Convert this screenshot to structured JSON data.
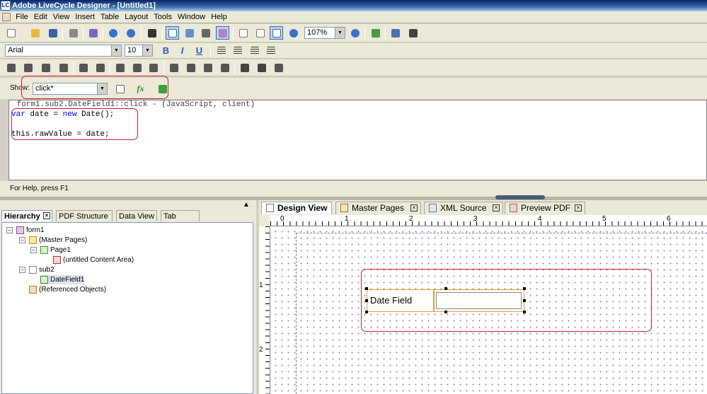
{
  "app": {
    "title": "Adobe LiveCycle Designer - [Untitled1]",
    "icon_text": "LC"
  },
  "menu": [
    "File",
    "Edit",
    "View",
    "Insert",
    "Table",
    "Layout",
    "Tools",
    "Window",
    "Help"
  ],
  "toolbar": {
    "zoom": "107%",
    "font_name": "Arial",
    "font_size": "10"
  },
  "script_bar": {
    "show_label": "Show:",
    "event": "click*"
  },
  "script": {
    "header": " form1.sub2.DateField1::click - (JavaScript, client)",
    "line1_kw1": "var",
    "line1_rest1": " date = ",
    "line1_kw2": "new",
    "line1_rest2": " Date();",
    "line2": "this.rawValue = date;"
  },
  "status": "For Help, press F1",
  "left_tabs": [
    "Hierarchy",
    "PDF Structure",
    "Data View",
    "Tab Order"
  ],
  "tree": {
    "form1": "form1",
    "master_pages": "(Master Pages)",
    "page1": "Page1",
    "content_area": "(untitled Content Area)",
    "sub2": "sub2",
    "datefield": "DateField1",
    "referenced": "(Referenced Objects)"
  },
  "doc_tabs": [
    "Design View",
    "Master Pages",
    "XML Source",
    "Preview PDF"
  ],
  "ruler": {
    "h": [
      "0",
      "1",
      "2",
      "3",
      "4",
      "5",
      "6"
    ],
    "v": [
      "1",
      "2"
    ]
  },
  "form": {
    "caption": "Date Field"
  },
  "colors": {
    "highlight": "#c21f2f",
    "keyword": "#0000ff",
    "title_bar": "#0a246a"
  }
}
